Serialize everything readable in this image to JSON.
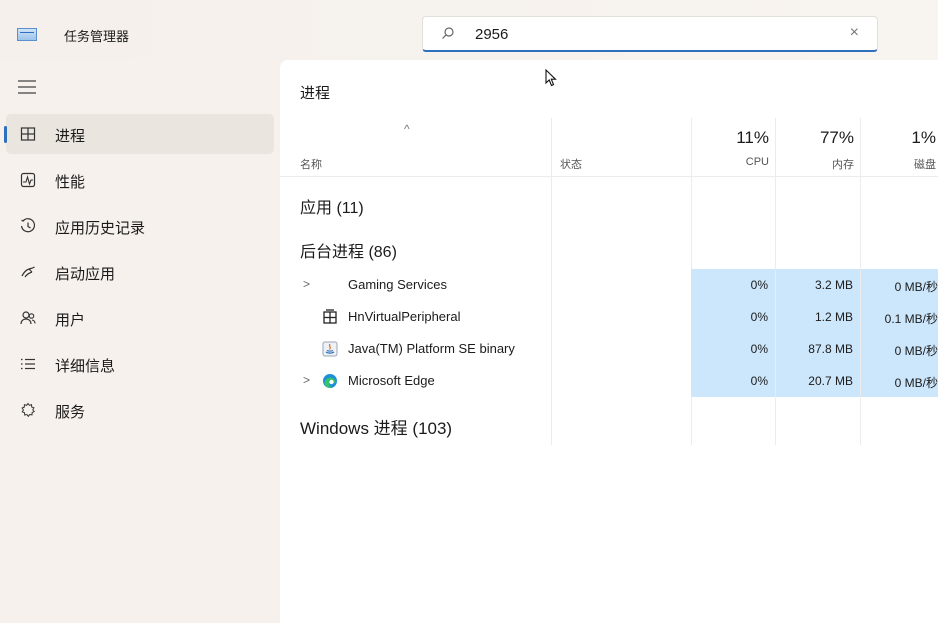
{
  "app": {
    "title": "任务管理器"
  },
  "search": {
    "value": "2956",
    "clear_label": "×"
  },
  "sidebar": {
    "items": [
      {
        "label": "进程",
        "icon": "processes-icon"
      },
      {
        "label": "性能",
        "icon": "performance-icon"
      },
      {
        "label": "应用历史记录",
        "icon": "app-history-icon"
      },
      {
        "label": "启动应用",
        "icon": "startup-apps-icon"
      },
      {
        "label": "用户",
        "icon": "users-icon"
      },
      {
        "label": "详细信息",
        "icon": "details-icon"
      },
      {
        "label": "服务",
        "icon": "services-icon"
      }
    ]
  },
  "main": {
    "title": "进程",
    "columns": {
      "name": "名称",
      "status": "状态",
      "cpu": {
        "pct": "11%",
        "label": "CPU"
      },
      "memory": {
        "pct": "77%",
        "label": "内存"
      },
      "disk": {
        "pct": "1%",
        "label": "磁盘"
      }
    },
    "sections": {
      "apps": "应用 (11)",
      "background": "后台进程 (86)",
      "windows": "Windows 进程 (103)"
    },
    "rows": [
      {
        "name": "Gaming Services",
        "cpu": "0%",
        "memory": "3.2 MB",
        "disk": "0 MB/秒"
      },
      {
        "name": "HnVirtualPeripheral",
        "cpu": "0%",
        "memory": "1.2 MB",
        "disk": "0.1 MB/秒"
      },
      {
        "name": "Java(TM) Platform SE binary",
        "cpu": "0%",
        "memory": "87.8 MB",
        "disk": "0 MB/秒"
      },
      {
        "name": "Microsoft Edge",
        "cpu": "0%",
        "memory": "20.7 MB",
        "disk": "0 MB/秒"
      }
    ]
  },
  "colors": {
    "accent": "#2f6fbf",
    "highlight": "#cce6fb",
    "sidebar_bg": "#f6f1ec"
  }
}
